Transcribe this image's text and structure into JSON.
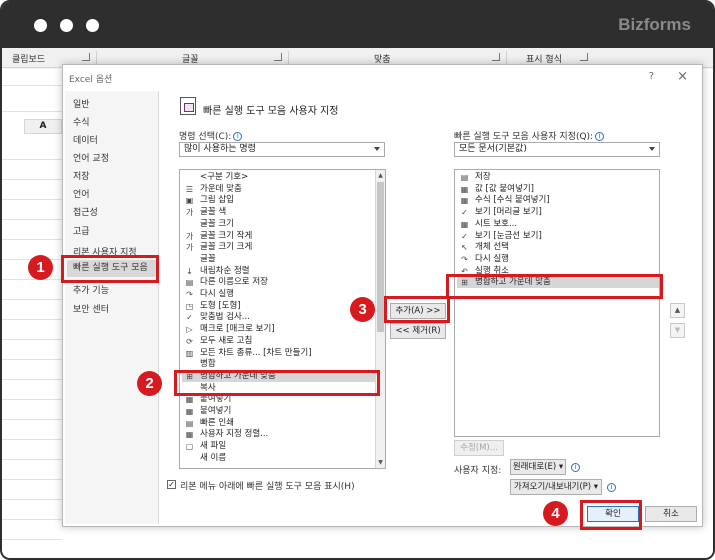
{
  "brand": "Bizforms",
  "ribbon": {
    "groups": [
      "클립보드",
      "글꼴",
      "맞춤",
      "표시 형식"
    ],
    "column_header": "A"
  },
  "dialog": {
    "title": "Excel 옵션",
    "help": "?",
    "close": "×",
    "sidebar": [
      "일반",
      "수식",
      "데이터",
      "언어 교정",
      "저장",
      "언어",
      "접근성",
      "고급",
      "리본 사용자 지정",
      "빠른 실행 도구 모음",
      "추가 기능",
      "보안 센터"
    ],
    "header_title": "빠른 실행 도구 모음 사용자 지정",
    "choose_label": "명령 선택(C):",
    "choose_value": "많이 사용하는 명령",
    "customize_label": "빠른 실행 도구 모음 사용자 지정(Q):",
    "customize_value": "모든 문서(기본값)",
    "left_items": [
      {
        "icon": "",
        "label": "<구분 기호>",
        "icon_name": "separator"
      },
      {
        "icon": "☰",
        "label": "가운데 맞춤",
        "icon_name": "align-center-icon"
      },
      {
        "icon": "▣",
        "label": "그림 삽입",
        "icon_name": "picture-icon"
      },
      {
        "icon": "가",
        "label": "글꼴 색",
        "icon_name": "font-color-icon"
      },
      {
        "icon": "",
        "label": "글꼴 크기",
        "icon_name": "font-size"
      },
      {
        "icon": "가",
        "label": "글꼴 크기 작게",
        "icon_name": "font-smaller-icon"
      },
      {
        "icon": "가",
        "label": "글꼴 크기 크게",
        "icon_name": "font-larger-icon"
      },
      {
        "icon": "",
        "label": "글꼴",
        "icon_name": "font"
      },
      {
        "icon": "↓",
        "label": "내림차순 정렬",
        "icon_name": "sort-desc-icon"
      },
      {
        "icon": "▤",
        "label": "다른 이름으로 저장",
        "icon_name": "save-as-icon"
      },
      {
        "icon": "↷",
        "label": "다시 실행",
        "icon_name": "redo-icon"
      },
      {
        "icon": "◳",
        "label": "도형 [도형]",
        "icon_name": "shapes-icon"
      },
      {
        "icon": "✓",
        "label": "맞춤법 검사...",
        "icon_name": "spelling-icon"
      },
      {
        "icon": "▷",
        "label": "매크로 [매크로 보기]",
        "icon_name": "macro-icon"
      },
      {
        "icon": "⟳",
        "label": "모두 새로 고침",
        "icon_name": "refresh-all-icon"
      },
      {
        "icon": "▥",
        "label": "모든 차트 종류... [차트 만들기]",
        "icon_name": "chart-icon"
      },
      {
        "icon": "",
        "label": "병합",
        "icon_name": "merge"
      },
      {
        "icon": "⊞",
        "label": "병합하고 가운데 맞춤",
        "icon_name": "merge-center-icon"
      },
      {
        "icon": "",
        "label": "복사",
        "icon_name": "copy"
      },
      {
        "icon": "▦",
        "label": "붙여넣기",
        "icon_name": "paste-icon"
      },
      {
        "icon": "▦",
        "label": "붙여넣기",
        "icon_name": "paste-icon"
      },
      {
        "icon": "▤",
        "label": "빠른 인쇄",
        "icon_name": "quick-print-icon"
      },
      {
        "icon": "▦",
        "label": "사용자 지정 정렬...",
        "icon_name": "custom-sort-icon"
      },
      {
        "icon": "▢",
        "label": "새 파일",
        "icon_name": "new-file-icon"
      },
      {
        "icon": "",
        "label": "새 이름",
        "icon_name": "new-name"
      }
    ],
    "right_items": [
      {
        "icon": "▤",
        "label": "저장",
        "icon_name": "save-icon"
      },
      {
        "icon": "▦",
        "label": "값 [값 붙여넣기]",
        "icon_name": "paste-values-icon"
      },
      {
        "icon": "▦",
        "label": "수식 [수식 붙여넣기]",
        "icon_name": "paste-formulas-icon"
      },
      {
        "icon": "✓",
        "label": "보기 [머리글 보기]",
        "icon_name": "check-icon"
      },
      {
        "icon": "▦",
        "label": "시트 보호...",
        "icon_name": "protect-sheet-icon"
      },
      {
        "icon": "✓",
        "label": "보기 [눈금선 보기]",
        "icon_name": "check-icon"
      },
      {
        "icon": "↖",
        "label": "개체 선택",
        "icon_name": "select-objects-icon"
      },
      {
        "icon": "↷",
        "label": "다시 실행",
        "icon_name": "redo-icon"
      },
      {
        "icon": "↶",
        "label": "실행 취소",
        "icon_name": "undo-icon"
      },
      {
        "icon": "⊞",
        "label": "병합하고 가운데 맞춤",
        "icon_name": "merge-center-icon"
      }
    ],
    "add_button": "추가(A) >>",
    "remove_button": "<< 제거(R)",
    "modify_button": "수정(M)...",
    "customizations_label": "사용자 지정:",
    "reset_button": "원래대로(E) ▾",
    "import_export_button": "가져오기/내보내기(P) ▾",
    "show_below_label": "리본 메뉴 아래에 빠른 실행 도구 모음 표시(H)",
    "ok_button": "확인",
    "cancel_button": "취소"
  },
  "callouts": [
    "1",
    "2",
    "3",
    "4"
  ],
  "colors": {
    "callout": "#d71920",
    "titlebar": "#2e2e2e"
  }
}
